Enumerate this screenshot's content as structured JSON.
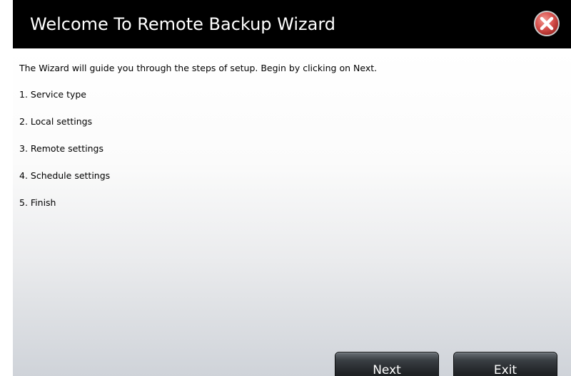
{
  "dialog": {
    "title": "Welcome To Remote Backup Wizard",
    "close_icon": "close-x-circle-icon",
    "intro": "The Wizard will guide you through the steps of setup. Begin by clicking on Next.",
    "steps": [
      "1. Service type",
      "2. Local settings",
      "3. Remote settings",
      "4. Schedule settings",
      "5. Finish"
    ],
    "buttons": {
      "next_label": "Next",
      "exit_label": "Exit"
    }
  },
  "colors": {
    "titlebar": "#000000",
    "title_text": "#ffffff",
    "close_icon": "#d9534f",
    "button": "#202326"
  }
}
